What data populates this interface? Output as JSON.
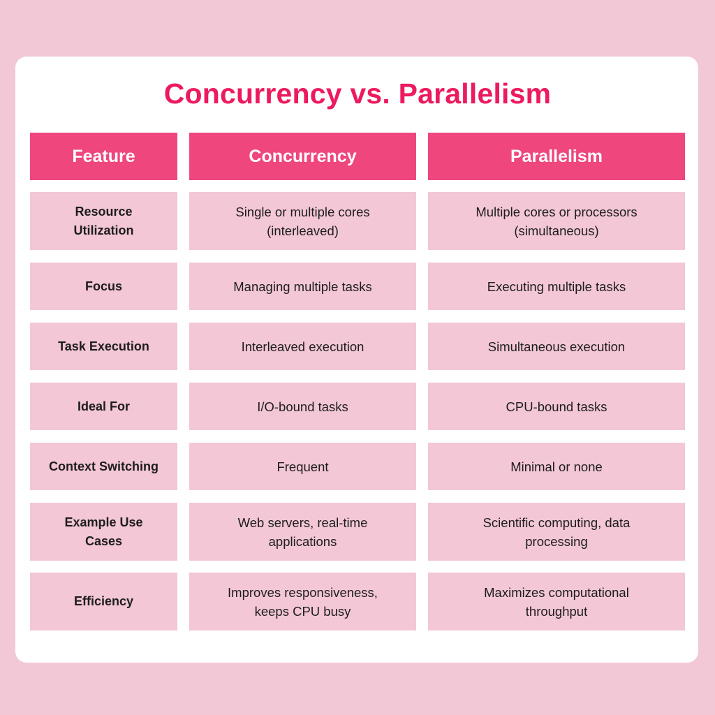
{
  "title": "Concurrency vs. Parallelism",
  "colors": {
    "background": "#f3c8d6",
    "card": "#ffffff",
    "title": "#ec1a5e",
    "header_fill": "#ef467e",
    "cell_fill": "#f3c7d5"
  },
  "table": {
    "headers": [
      "Feature",
      "Concurrency",
      "Parallelism"
    ],
    "rows": [
      {
        "feature": "Resource Utilization",
        "concurrency": "Single or multiple cores (interleaved)",
        "parallelism": "Multiple cores or processors (simultaneous)"
      },
      {
        "feature": "Focus",
        "concurrency": "Managing multiple tasks",
        "parallelism": "Executing multiple tasks"
      },
      {
        "feature": "Task Execution",
        "concurrency": "Interleaved execution",
        "parallelism": "Simultaneous execution"
      },
      {
        "feature": "Ideal For",
        "concurrency": "I/O-bound tasks",
        "parallelism": "CPU-bound tasks"
      },
      {
        "feature": "Context Switching",
        "concurrency": "Frequent",
        "parallelism": "Minimal or none"
      },
      {
        "feature": "Example Use Cases",
        "concurrency": "Web servers, real-time applications",
        "parallelism": "Scientific computing, data processing"
      },
      {
        "feature": "Efficiency",
        "concurrency": "Improves responsiveness, keeps CPU busy",
        "parallelism": "Maximizes computational throughput"
      }
    ]
  }
}
